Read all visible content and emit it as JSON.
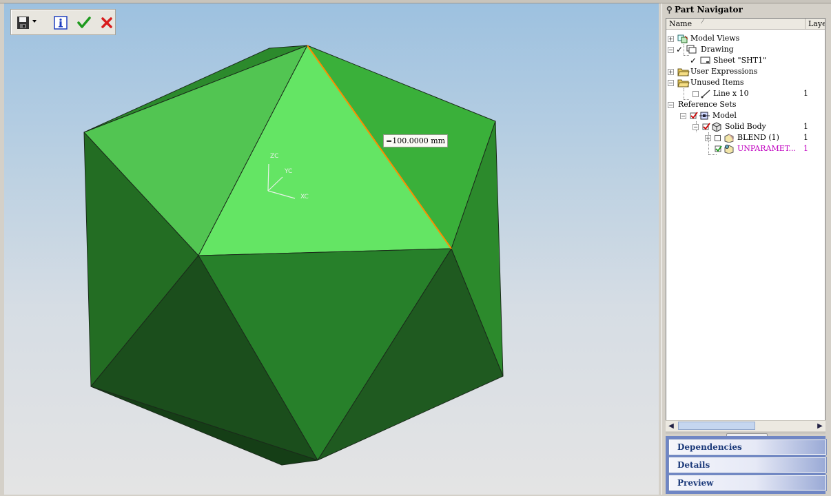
{
  "toolbar": {
    "save": "save-icon",
    "info": "information-icon",
    "ok": "checkmark-icon",
    "cancel": "cancel-icon"
  },
  "viewport": {
    "dimension_label": "=100.0000 mm",
    "triad": {
      "z": "ZC",
      "y": "YC",
      "x": "XC"
    }
  },
  "navigator": {
    "title": "Part Navigator",
    "columns": {
      "name": "Name",
      "layer": "Layer"
    },
    "tree": [
      {
        "label": "Model Views",
        "layer": ""
      },
      {
        "label": "Drawing",
        "layer": ""
      },
      {
        "label": "Sheet \"SHT1\"",
        "layer": ""
      },
      {
        "label": "User Expressions",
        "layer": ""
      },
      {
        "label": "Unused Items",
        "layer": ""
      },
      {
        "label": "Line x 10",
        "layer": "1"
      },
      {
        "label": "Reference Sets",
        "layer": ""
      },
      {
        "label": "Model",
        "layer": ""
      },
      {
        "label": "Solid Body",
        "layer": "1"
      },
      {
        "label": "BLEND (1)",
        "layer": "1"
      },
      {
        "label": "UNPARAMET...",
        "layer": "1"
      }
    ],
    "panels": [
      "Dependencies",
      "Details",
      "Preview"
    ]
  },
  "colors": {
    "face_light": "#64e564",
    "face_mid": "#2a8a2a",
    "face_dark": "#1c5c1c",
    "highlight_edge": "#ff8c00",
    "unparam_text": "#c000c0"
  }
}
